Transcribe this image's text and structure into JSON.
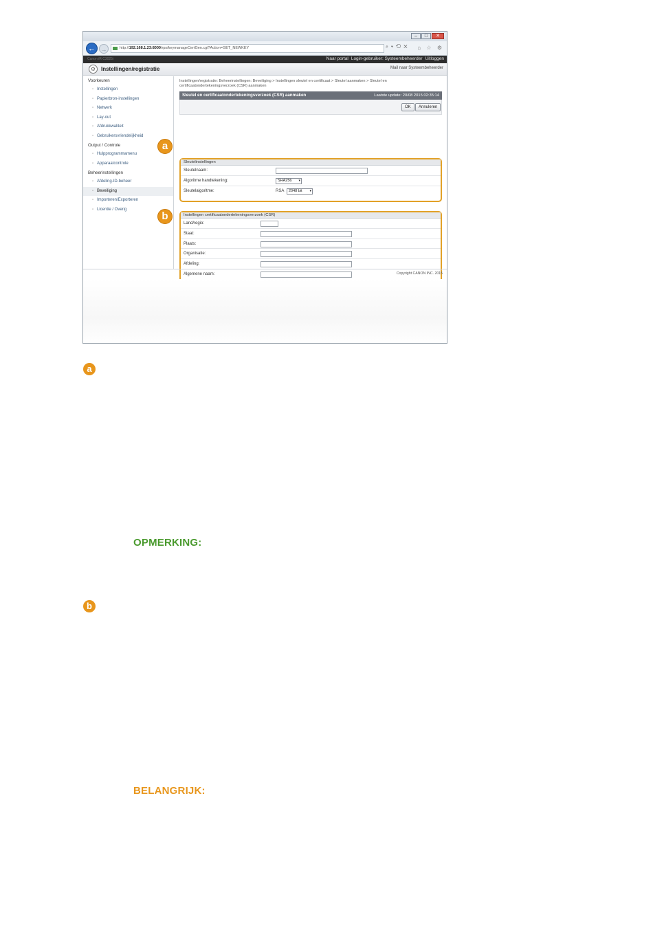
{
  "browser": {
    "url_host": "192.168.1.23:8000",
    "url_prefix": "http://",
    "url_path": "/rps/keymanageCertGen.cgi?Action=GET_NEWKEY",
    "tab_text": "Canon iR   C3025i",
    "search_glyphs": "⌕ ▾ ⟲ ✕",
    "icons": "⌂ ☆ ⚙"
  },
  "topnav": {
    "links": [
      "Naar portal",
      "Login-gebruiker: Systeembeheerder",
      "Uitloggen"
    ]
  },
  "header": {
    "title": "Instellingen/registratie",
    "mail_link": "Mail naar Systeembeheerder"
  },
  "sidebar": {
    "groups": [
      {
        "label": "Voorkeuren",
        "items": [
          "Instellingen",
          "Papierbron-instellingen",
          "Netwerk",
          "Lay-out",
          "Afdrukkwaliteit",
          "Gebruikersvriendelijkheid"
        ]
      },
      {
        "label": "Output / Controle",
        "items": [
          "Hulpprogrammamenu",
          "Apparaatcontrole"
        ]
      },
      {
        "label": "Beheerinstellingen",
        "items": [
          "Afdeling-ID-beheer",
          "Beveiliging",
          "Importeren/Exporteren",
          "Licentie / Overig"
        ]
      }
    ],
    "active_item": "Beveiliging"
  },
  "content": {
    "breadcrumb": "Instellingen/registratie: Beheerinstellingen: Beveiliging > Instellingen sleutel en certificaat > Sleutel aanmaken > Sleutel en certificaatondertekeningsverzoek (CSR) aanmaken",
    "title": "Sleutel en certificaatondertekeningsverzoek (CSR) aanmaken",
    "last_update": "Laatste update: 20/08 2015 02:35:14",
    "ok_label": "OK",
    "cancel_label": "Annuleren"
  },
  "key_settings": {
    "title": "Sleutelinstellingen",
    "name_label": "Sleutelnaam:",
    "name_value": "",
    "sig_label": "Algoritme handtekening:",
    "sig_value": "SHA256",
    "alg_label": "Sleutelalgoritme:",
    "alg_prefix": "RSA",
    "alg_value": "2048 bit"
  },
  "csr_settings": {
    "title": "Instellingen certificaatondertekeningsverzoek (CSR)",
    "fields": [
      "Land/regio:",
      "Staat:",
      "Plaats:",
      "Organisatie:",
      "Afdeling:",
      "Algemene naam:"
    ]
  },
  "footer": {
    "copyright": "Copyright CANON INC. 2015"
  },
  "callouts": {
    "a": "a",
    "b": "b"
  },
  "doc": {
    "badge_a": "a",
    "badge_b": "b",
    "note": "OPMERKING:",
    "important": "BELANGRIJK:"
  },
  "colors": {
    "accent": "#e8961c",
    "note_green": "#4a9a2e",
    "title_strip": "#6b7079"
  }
}
